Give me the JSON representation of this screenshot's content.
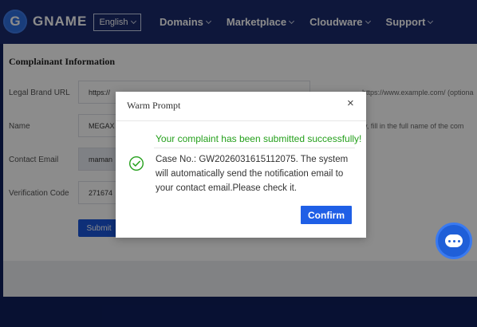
{
  "header": {
    "logo_letter": "G",
    "logo_text": "GNAME",
    "language": "English",
    "nav": [
      "Domains",
      "Marketplace",
      "Cloudware",
      "Support"
    ]
  },
  "form": {
    "section_title": "Complainant Information",
    "legal_brand_url": {
      "label": "Legal Brand URL",
      "value": "https://",
      "hint": "https://www.example.com/  (optiona"
    },
    "name": {
      "label": "Name",
      "value": "MEGAX",
      "hint": "y, fill in the full name of the com"
    },
    "contact_email": {
      "label": "Contact Email",
      "value": "maman"
    },
    "verification_code": {
      "label": "Verification Code",
      "value": "271674"
    },
    "submit_label": "Submit"
  },
  "modal": {
    "title": "Warm Prompt",
    "close_glyph": "×",
    "success_message": "Your complaint has been submitted successfully!",
    "case_text": "Case No.: GW2026031615112075. The system will automatically send the notification email to your contact email.Please check it.",
    "confirm_label": "Confirm"
  },
  "colors": {
    "header_bg": "#1a2a6c",
    "success_green": "#25a01c",
    "primary_blue": "#1f5fe6"
  }
}
